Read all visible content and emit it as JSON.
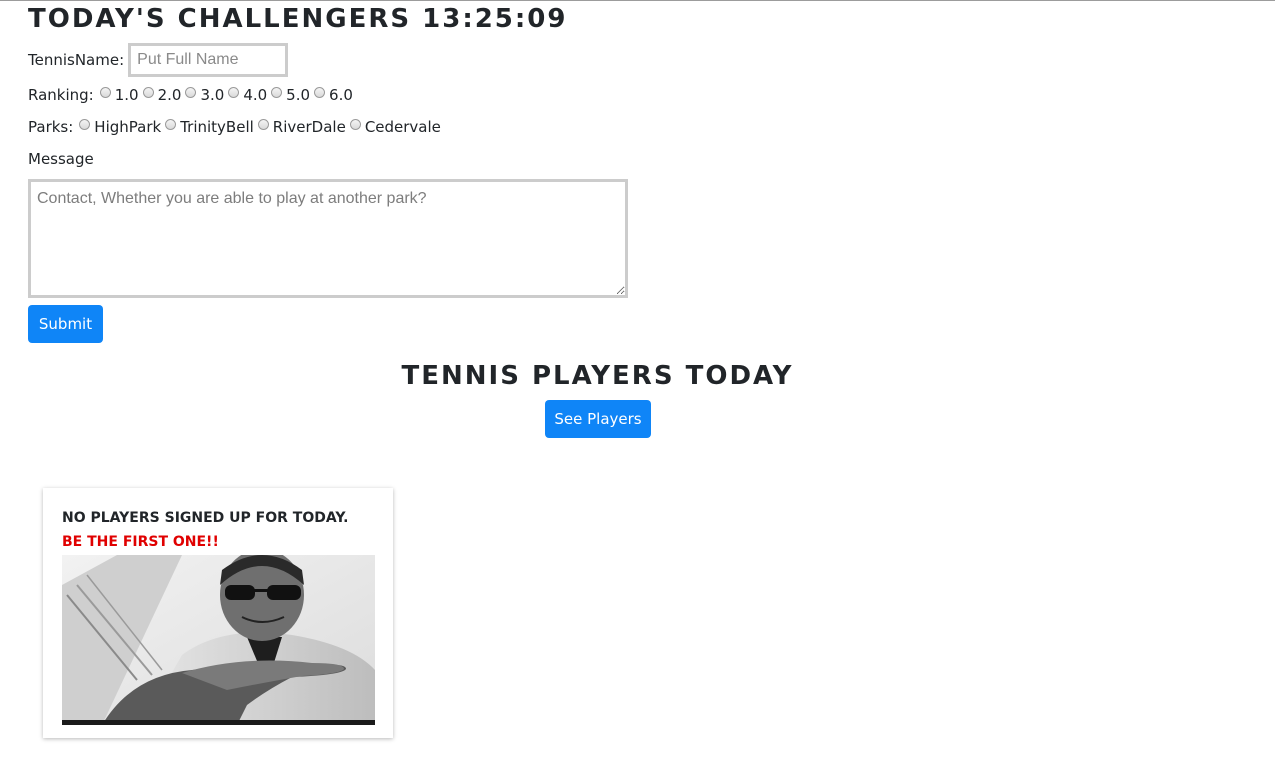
{
  "header": {
    "title": "TODAY'S CHALLENGERS 13:25:09"
  },
  "form": {
    "name_label": "TennisName:",
    "name_placeholder": "Put Full Name",
    "ranking_label": "Ranking:",
    "ranking_options": [
      "1.0",
      "2.0",
      "3.0",
      "4.0",
      "5.0",
      "6.0"
    ],
    "parks_label": "Parks:",
    "parks_options": [
      "HighPark",
      "TrinityBell",
      "RiverDale",
      "Cedervale"
    ],
    "message_label": "Message",
    "message_placeholder": "Contact, Whether you are able to play at another park?",
    "submit_label": "Submit"
  },
  "players_section": {
    "title": "TENNIS PLAYERS TODAY",
    "see_players_label": "See Players"
  },
  "empty_card": {
    "title": "NO PLAYERS SIGNED UP FOR TODAY.",
    "subtitle": "BE THE FIRST ONE!!",
    "subtitle_color": "#e00000"
  },
  "colors": {
    "accent": "#0f85f7",
    "text": "#212529"
  }
}
